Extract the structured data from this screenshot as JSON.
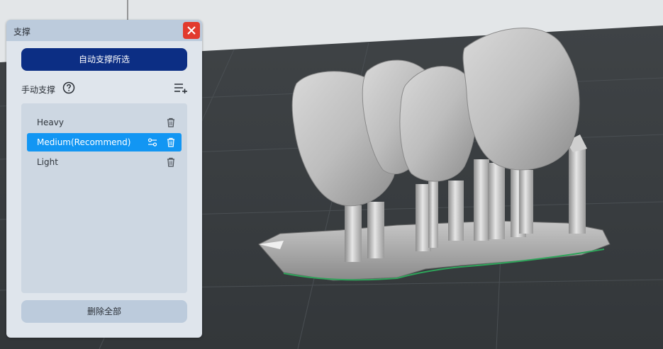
{
  "panel": {
    "title": "支撑",
    "auto_button_label": "自动支撑所选",
    "manual_label": "手动支撑",
    "items": [
      {
        "label": "Heavy",
        "selected": false
      },
      {
        "label": "Medium(Recommend)",
        "selected": true
      },
      {
        "label": "Light",
        "selected": false
      }
    ],
    "delete_all_label": "删除全部"
  },
  "colors": {
    "accent": "#0c2e84",
    "selected": "#1296f3",
    "close": "#e23a2e"
  }
}
